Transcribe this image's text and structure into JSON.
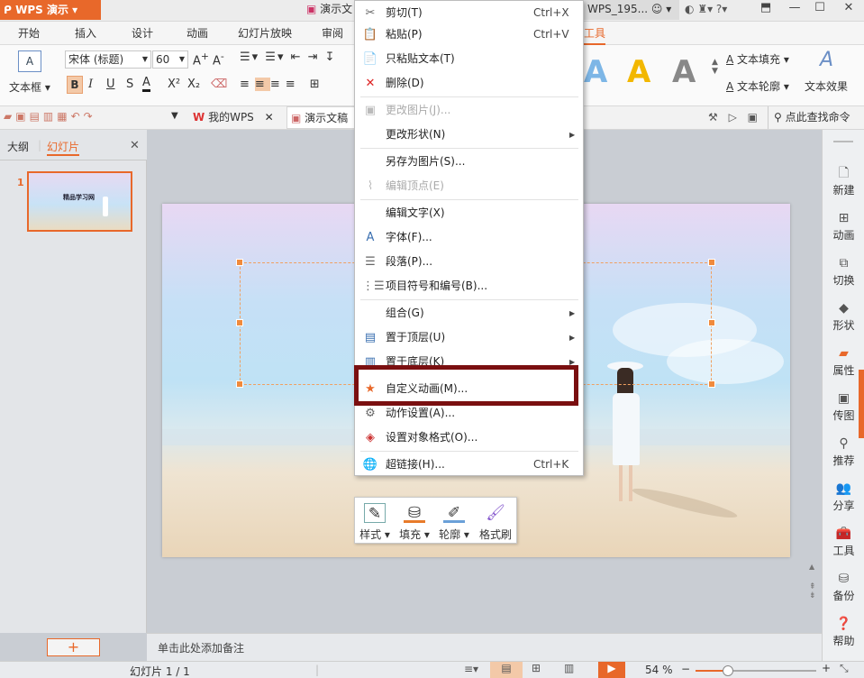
{
  "title_bar": {
    "app_name": "WPS 演示",
    "app_dropdown": "▾",
    "doc_title": "演示文",
    "window_title": "WPS_195...",
    "right_icons": [
      "ring-icon",
      "sync-icon",
      "shirt-icon",
      "help-icon"
    ]
  },
  "tabs": [
    "开始",
    "插入",
    "设计",
    "动画",
    "幻灯片放映",
    "审阅",
    "工具"
  ],
  "ribbon": {
    "textbox_label": "文本框",
    "font_name": "宋体 (标题)",
    "font_size": "60",
    "text_fill": "文本填充",
    "text_outline": "文本轮廓",
    "text_effect": "文本效果",
    "format_buttons": [
      "B",
      "I",
      "U",
      "S",
      "A",
      "X²",
      "X₂"
    ]
  },
  "quickbar": {
    "tab_mywps": "我的WPS",
    "tab_doc": "演示文稿",
    "search_placeholder": "点此查找命令"
  },
  "left_panel": {
    "tab_outline": "大纲",
    "tab_slides": "幻灯片",
    "slide_number": "1",
    "thumb_title": "精品学习网",
    "add_button": "+"
  },
  "context_menu": {
    "items": [
      {
        "label": "剪切(T)",
        "shortcut": "Ctrl+X",
        "icon": "scissors-icon",
        "disabled": false,
        "submenu": false
      },
      {
        "label": "粘贴(P)",
        "shortcut": "Ctrl+V",
        "icon": "paste-icon",
        "disabled": false,
        "submenu": false
      },
      {
        "label": "只粘贴文本(T)",
        "shortcut": "",
        "icon": "paste-text-icon",
        "disabled": false,
        "submenu": false
      },
      {
        "label": "删除(D)",
        "shortcut": "",
        "icon": "delete-icon",
        "disabled": false,
        "submenu": false
      },
      {
        "label": "更改图片(J)...",
        "shortcut": "",
        "icon": "change-picture-icon",
        "disabled": true,
        "submenu": false
      },
      {
        "label": "更改形状(N)",
        "shortcut": "",
        "icon": "",
        "disabled": false,
        "submenu": true
      },
      {
        "label": "另存为图片(S)...",
        "shortcut": "",
        "icon": "",
        "disabled": false,
        "submenu": false
      },
      {
        "label": "编辑顶点(E)",
        "shortcut": "",
        "icon": "edit-points-icon",
        "disabled": true,
        "submenu": false
      },
      {
        "label": "编辑文字(X)",
        "shortcut": "",
        "icon": "",
        "disabled": false,
        "submenu": false
      },
      {
        "label": "字体(F)...",
        "shortcut": "",
        "icon": "font-icon",
        "disabled": false,
        "submenu": false
      },
      {
        "label": "段落(P)...",
        "shortcut": "",
        "icon": "paragraph-icon",
        "disabled": false,
        "submenu": false
      },
      {
        "label": "项目符号和编号(B)...",
        "shortcut": "",
        "icon": "bullets-icon",
        "disabled": false,
        "submenu": false
      },
      {
        "label": "组合(G)",
        "shortcut": "",
        "icon": "",
        "disabled": false,
        "submenu": true
      },
      {
        "label": "置于顶层(U)",
        "shortcut": "",
        "icon": "bring-front-icon",
        "disabled": false,
        "submenu": true
      },
      {
        "label": "置于底层(K)",
        "shortcut": "",
        "icon": "send-back-icon",
        "disabled": false,
        "submenu": true
      },
      {
        "label": "自定义动画(M)...",
        "shortcut": "",
        "icon": "custom-animation-icon",
        "disabled": false,
        "submenu": false
      },
      {
        "label": "动作设置(A)...",
        "shortcut": "",
        "icon": "action-settings-icon",
        "disabled": false,
        "submenu": false
      },
      {
        "label": "设置对象格式(O)...",
        "shortcut": "",
        "icon": "format-object-icon",
        "disabled": false,
        "submenu": false
      },
      {
        "label": "超链接(H)...",
        "shortcut": "Ctrl+K",
        "icon": "hyperlink-icon",
        "disabled": false,
        "submenu": false
      }
    ]
  },
  "float_toolbar": {
    "items": [
      {
        "label": "样式 ▾",
        "icon": "style-icon"
      },
      {
        "label": "填充 ▾",
        "icon": "fill-bucket-icon"
      },
      {
        "label": "轮廓 ▾",
        "icon": "outline-pen-icon"
      },
      {
        "label": "格式刷",
        "icon": "format-brush-icon"
      }
    ]
  },
  "right_panel": {
    "items": [
      {
        "label": "新建",
        "icon": "new-doc-icon"
      },
      {
        "label": "动画",
        "icon": "animation-icon"
      },
      {
        "label": "切换",
        "icon": "transition-icon"
      },
      {
        "label": "形状",
        "icon": "shape-icon"
      },
      {
        "label": "属性",
        "icon": "properties-icon"
      },
      {
        "label": "传图",
        "icon": "upload-image-icon"
      },
      {
        "label": "推荐",
        "icon": "recommend-icon"
      },
      {
        "label": "分享",
        "icon": "share-icon"
      },
      {
        "label": "工具",
        "icon": "toolbox-icon"
      },
      {
        "label": "备份",
        "icon": "backup-icon"
      },
      {
        "label": "帮助",
        "icon": "help-icon"
      }
    ]
  },
  "notes_placeholder": "单击此处添加备注",
  "status_bar": {
    "slide_info": "幻灯片 1 / 1",
    "zoom": "54 %",
    "zoom_level": 0.54
  },
  "colors": {
    "accent": "#e8682a",
    "highlight_border": "#7a0f10",
    "handle": "#f08a3c"
  }
}
